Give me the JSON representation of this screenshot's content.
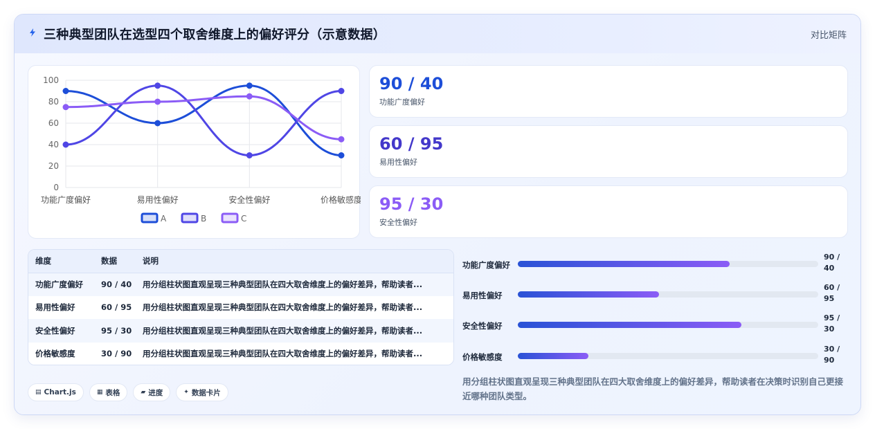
{
  "header": {
    "title": "三种典型团队在选型四个取舍维度上的偏好评分（示意数据）",
    "right_link": "对比矩阵",
    "icon": "lightning-icon"
  },
  "chart_data": {
    "type": "line",
    "categories": [
      "功能广度偏好",
      "易用性偏好",
      "安全性偏好",
      "价格敏感度"
    ],
    "ylim": [
      0,
      100
    ],
    "yticks": [
      0,
      20,
      40,
      60,
      80,
      100
    ],
    "grid": true,
    "legend_position": "bottom",
    "series": [
      {
        "name": "A",
        "values": [
          90,
          60,
          95,
          30
        ],
        "color": "#1d4ed8"
      },
      {
        "name": "B",
        "values": [
          40,
          95,
          30,
          90
        ],
        "color": "#4f46e5"
      },
      {
        "name": "C",
        "values": [
          75,
          80,
          85,
          45
        ],
        "color": "#8b5cf6"
      }
    ]
  },
  "stats": [
    {
      "value": "90 / 40",
      "label": "功能广度偏好",
      "color": "#1d4ed8"
    },
    {
      "value": "60 / 95",
      "label": "易用性偏好",
      "color": "#4338ca"
    },
    {
      "value": "95 / 30",
      "label": "安全性偏好",
      "color": "#8b5cf6"
    }
  ],
  "table": {
    "headers": [
      "维度",
      "数据",
      "说明"
    ],
    "rows": [
      {
        "dimension": "功能广度偏好",
        "data": "90 / 40",
        "desc": "用分组柱状图直观呈现三种典型团队在四大取舍维度上的偏好差异，帮助读者..."
      },
      {
        "dimension": "易用性偏好",
        "data": "60 / 95",
        "desc": "用分组柱状图直观呈现三种典型团队在四大取舍维度上的偏好差异，帮助读者..."
      },
      {
        "dimension": "安全性偏好",
        "data": "95 / 30",
        "desc": "用分组柱状图直观呈现三种典型团队在四大取舍维度上的偏好差异，帮助读者..."
      },
      {
        "dimension": "价格敏感度",
        "data": "30 / 90",
        "desc": "用分组柱状图直观呈现三种典型团队在四大取舍维度上的偏好差异，帮助读者..."
      }
    ]
  },
  "tags": [
    {
      "icon": "chart-icon",
      "glyph": "▤",
      "label": "Chart.js"
    },
    {
      "icon": "table-icon",
      "glyph": "▦",
      "label": "表格"
    },
    {
      "icon": "progress-icon",
      "glyph": "▰",
      "label": "进度"
    },
    {
      "icon": "sparkle-icon",
      "glyph": "✦",
      "label": "数据卡片"
    }
  ],
  "progress": [
    {
      "label": "功能广度偏好",
      "value": "90 / 40",
      "fraction": 0.705
    },
    {
      "label": "易用性偏好",
      "value": "60 / 95",
      "fraction": 0.47
    },
    {
      "label": "安全性偏好",
      "value": "95 / 30",
      "fraction": 0.745
    },
    {
      "label": "价格敏感度",
      "value": "30 / 90",
      "fraction": 0.235
    }
  ],
  "note": "用分组柱状图直观呈现三种典型团队在四大取舍维度上的偏好差异，帮助读者在决策时识别自己更接近哪种团队类型。"
}
